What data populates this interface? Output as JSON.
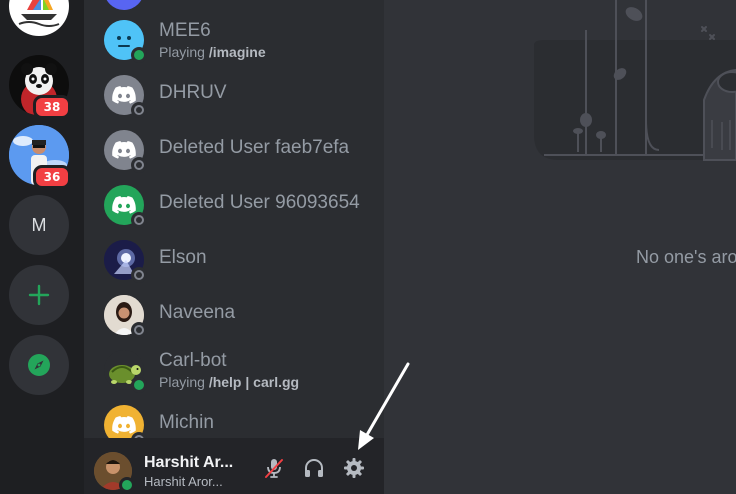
{
  "servers": {
    "items": [
      {
        "type": "image",
        "name": "sailboat-server"
      },
      {
        "type": "image",
        "name": "panda-server",
        "badge": "38"
      },
      {
        "type": "image",
        "name": "person-server",
        "badge": "36"
      },
      {
        "type": "letter",
        "label": "M"
      },
      {
        "type": "action",
        "name": "add-server"
      },
      {
        "type": "action",
        "name": "explore"
      }
    ],
    "accent": "#23a55a"
  },
  "dms": [
    {
      "name": "MEE6",
      "activity_prefix": "Playing",
      "activity_bold": "/imagine",
      "status": "online",
      "avatar": "mee6",
      "color": "#3ba5d6"
    },
    {
      "name": "DHRUV",
      "status": "offline",
      "avatar": "discord-logo",
      "color": "#80848e"
    },
    {
      "name": "Deleted User faeb7efa",
      "status": "offline",
      "avatar": "discord-logo",
      "color": "#80848e"
    },
    {
      "name": "Deleted User 96093654",
      "status": "offline",
      "avatar": "discord-logo",
      "color": "#23a55a"
    },
    {
      "name": "Elson",
      "status": "offline",
      "avatar": "photo",
      "color": "#2c2e6e"
    },
    {
      "name": "Naveena",
      "status": "offline",
      "avatar": "photo",
      "color": "#d9d2c8"
    },
    {
      "name": "Carl-bot",
      "activity_prefix": "Playing",
      "activity_bold": "/help | carl.gg",
      "status": "online",
      "avatar": "turtle",
      "color": "#2b2d31"
    },
    {
      "name": "Michin",
      "status": "offline",
      "avatar": "discord-logo",
      "color": "#f0b232"
    }
  ],
  "user": {
    "display_name": "Harshit Ar...",
    "username": "Harshit Aror...",
    "status": "online"
  },
  "controls": {
    "mic": "mic-muted-icon",
    "headphones": "headphones-icon",
    "settings": "gear-icon",
    "muted_color": "#f23f43"
  },
  "main": {
    "empty_text": "No one's arou"
  }
}
